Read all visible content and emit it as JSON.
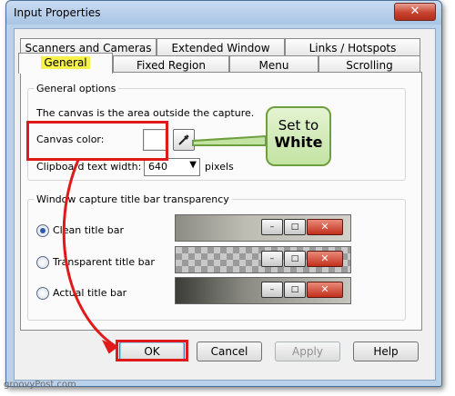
{
  "window": {
    "title": "Input Properties",
    "close_glyph": "✕"
  },
  "tabs": {
    "row_back": [
      "Scanners and Cameras",
      "Extended Window",
      "Links / Hotspots"
    ],
    "row_front": [
      "General",
      "Fixed Region",
      "Menu",
      "Scrolling"
    ],
    "selected": "General"
  },
  "general_options": {
    "legend": "General options",
    "description": "The canvas is the area outside the capture.",
    "canvas_color_label": "Canvas color:",
    "canvas_color_value": "#ffffff",
    "clipboard_label": "Clipboard text width:",
    "clipboard_value": "640",
    "clipboard_unit": "pixels"
  },
  "transparency": {
    "legend": "Window capture title bar transparency",
    "options": [
      "Clean title bar",
      "Transparent title bar",
      "Actual title bar"
    ],
    "selected": "Clean title bar"
  },
  "buttons": {
    "ok": "OK",
    "cancel": "Cancel",
    "apply": "Apply",
    "help": "Help"
  },
  "callout": {
    "line1": "Set to",
    "line2": "White"
  },
  "annotation_color": "#e01a1a",
  "callout_color": "#6e9e3d",
  "watermark": "groovyPost.com"
}
